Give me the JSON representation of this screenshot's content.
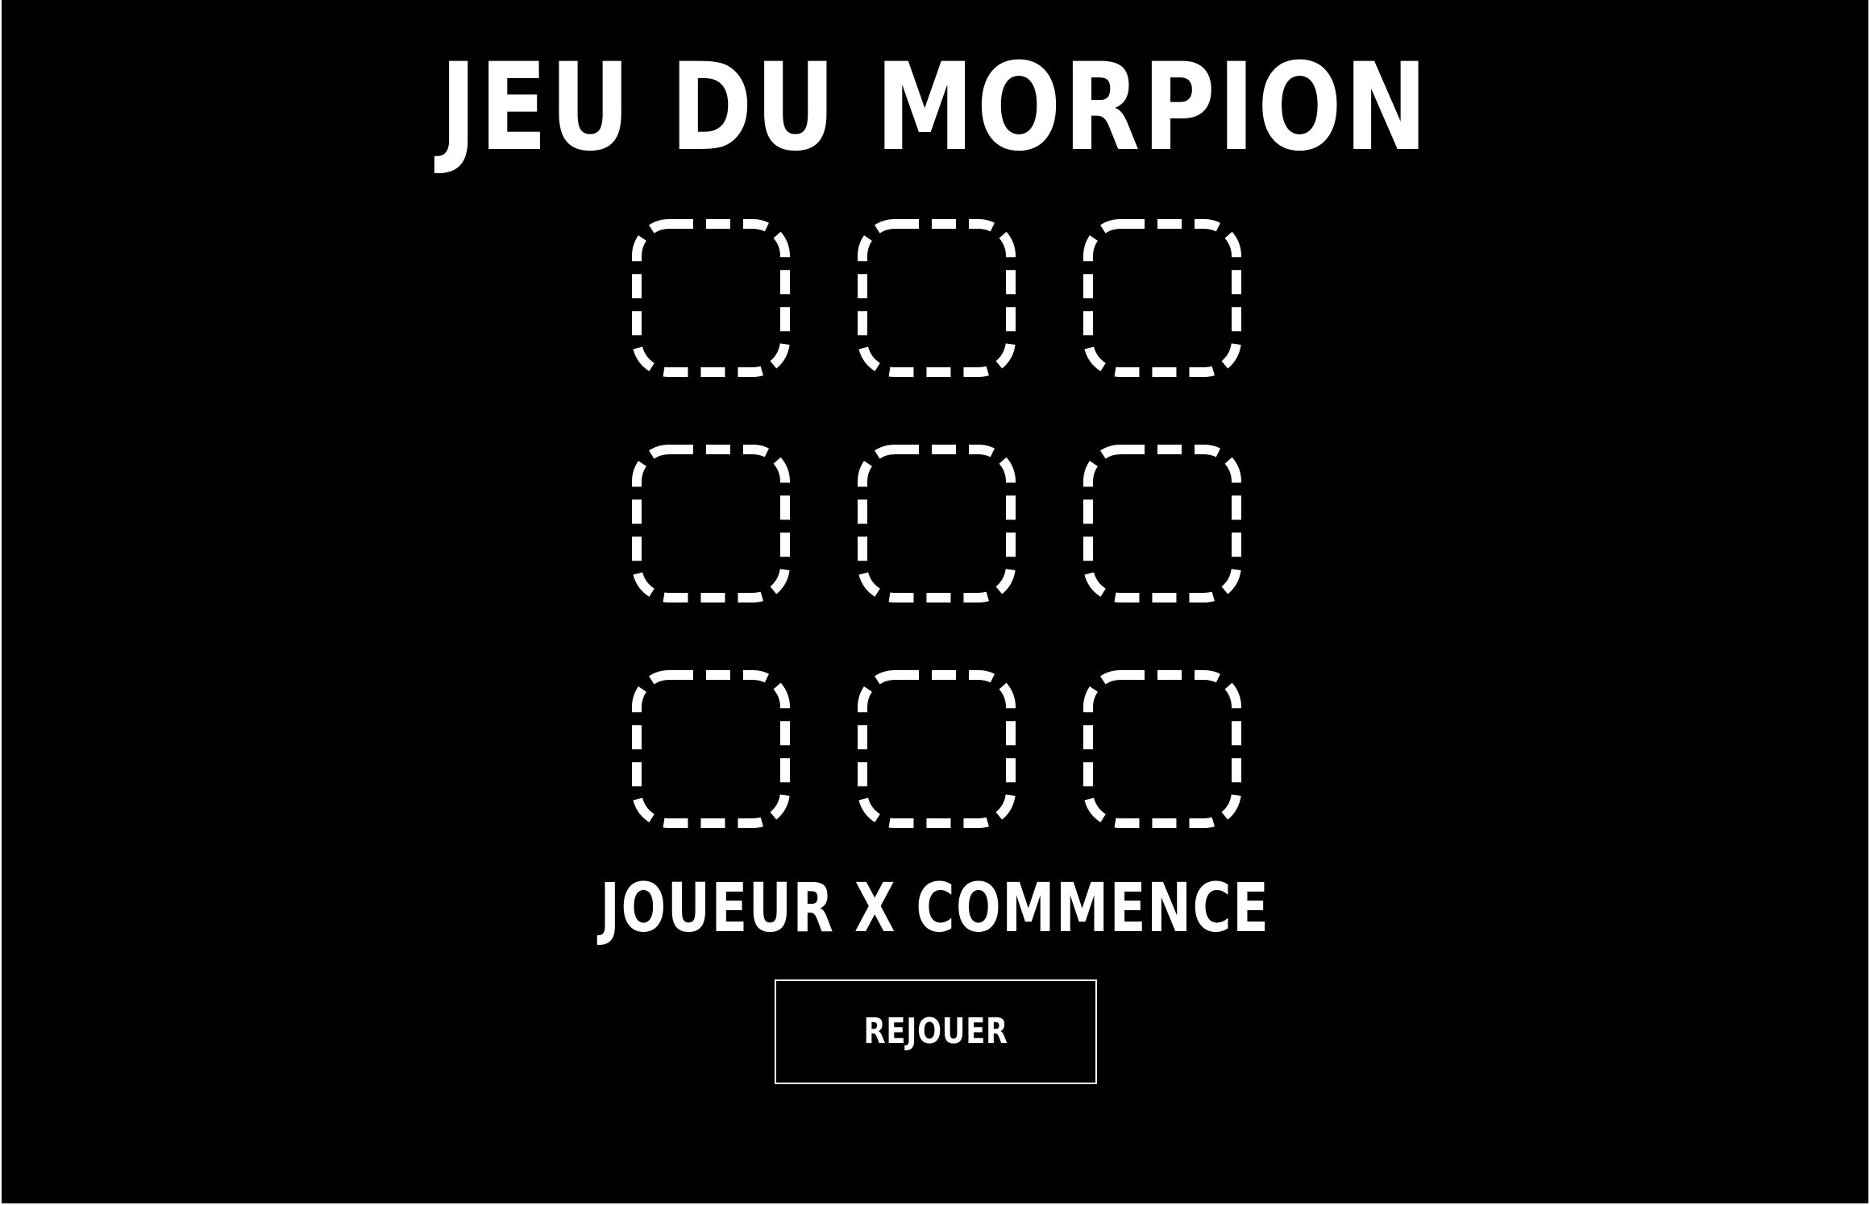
{
  "game": {
    "title": "JEU DU MORPION",
    "status": "JOUEUR X COMMENCE",
    "replay_label": "REJOUER",
    "board": [
      "",
      "",
      "",
      "",
      "",
      "",
      "",
      "",
      ""
    ]
  },
  "colors": {
    "background": "#000000",
    "foreground": "#ffffff"
  }
}
